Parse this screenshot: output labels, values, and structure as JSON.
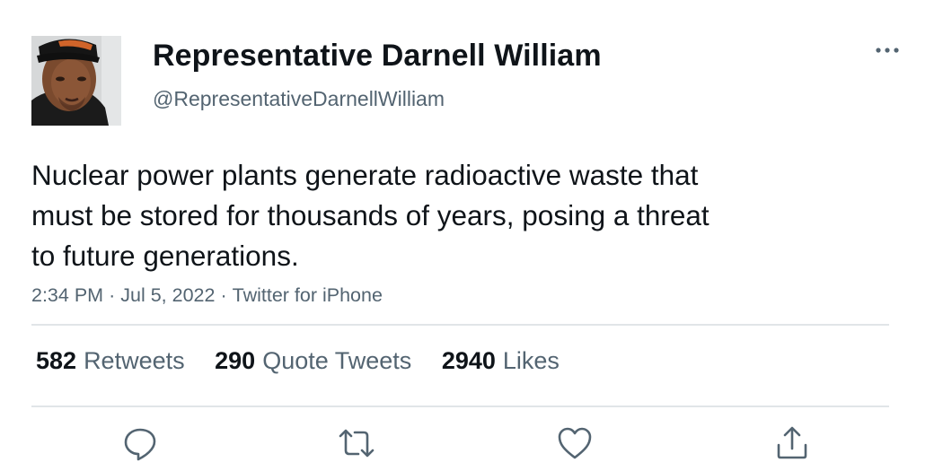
{
  "user": {
    "display_name": "Representative Darnell William",
    "handle": "@RepresentativeDarnellWilliam",
    "avatar_icon": "profile-photo"
  },
  "tweet": {
    "text_lines": [
      "Nuclear power plants generate radioactive waste that",
      "must be stored for thousands of years, posing a threat",
      "to future generations."
    ],
    "time": "2:34 PM",
    "date": "Jul 5, 2022",
    "source": "Twitter for iPhone",
    "separator": "·"
  },
  "stats": {
    "retweets_count": "582",
    "retweets_label": "Retweets",
    "quote_tweets_count": "290",
    "quote_tweets_label": "Quote Tweets",
    "likes_count": "2940",
    "likes_label": "Likes"
  },
  "actions": [
    "reply-icon",
    "retweet-icon",
    "like-icon",
    "share-icon"
  ],
  "colors": {
    "text": "#0f1419",
    "secondary": "#536471",
    "divider": "#e1e5e8",
    "icon": "#536471"
  }
}
